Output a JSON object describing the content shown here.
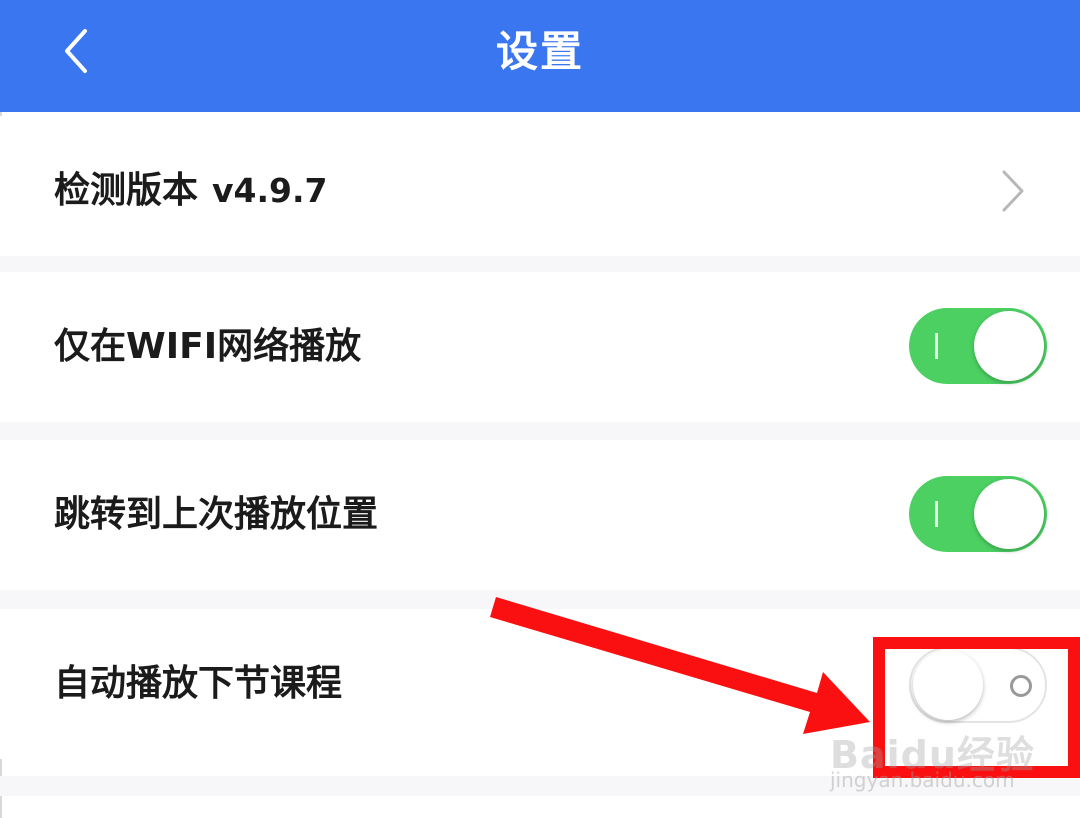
{
  "header": {
    "title": "设置",
    "background": "#3a76f0",
    "back_icon": "chevron-left-icon"
  },
  "settings": [
    {
      "label": "检测版本",
      "version": "v4.9.7",
      "control": "chevron-right-icon"
    },
    {
      "label": "仅在WIFI网络播放",
      "control": "toggle",
      "enabled": true
    },
    {
      "label": "跳转到上次播放位置",
      "control": "toggle",
      "enabled": true
    },
    {
      "label": "自动播放下节课程",
      "control": "toggle",
      "enabled": false
    }
  ],
  "colors": {
    "toggle_on": "#4cd062",
    "annotation_red": "#fa1010"
  },
  "watermark": {
    "logo": "Baidu经验",
    "url": "jingyan.baidu.com"
  }
}
